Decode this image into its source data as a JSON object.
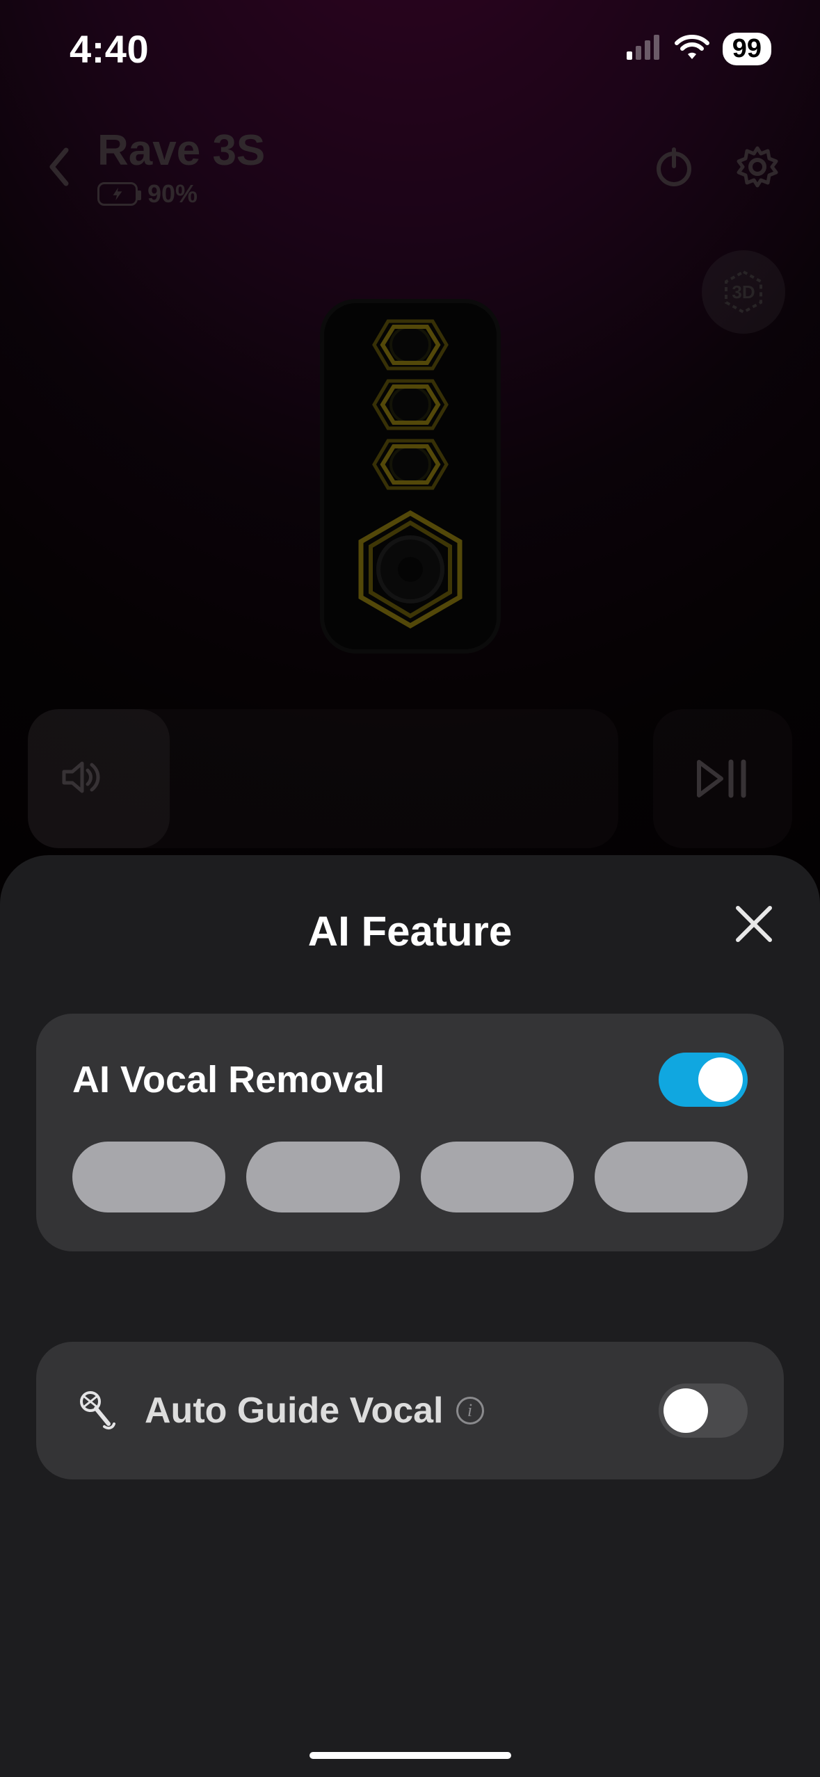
{
  "status": {
    "time": "4:40",
    "battery_percent": "99"
  },
  "header": {
    "device_name": "Rave 3S",
    "device_battery": "90%"
  },
  "threed_label": "3D",
  "sheet": {
    "title": "AI Feature",
    "vocal_removal": {
      "label": "AI Vocal Removal",
      "enabled": true
    },
    "auto_guide": {
      "label": "Auto Guide Vocal",
      "enabled": false
    }
  }
}
